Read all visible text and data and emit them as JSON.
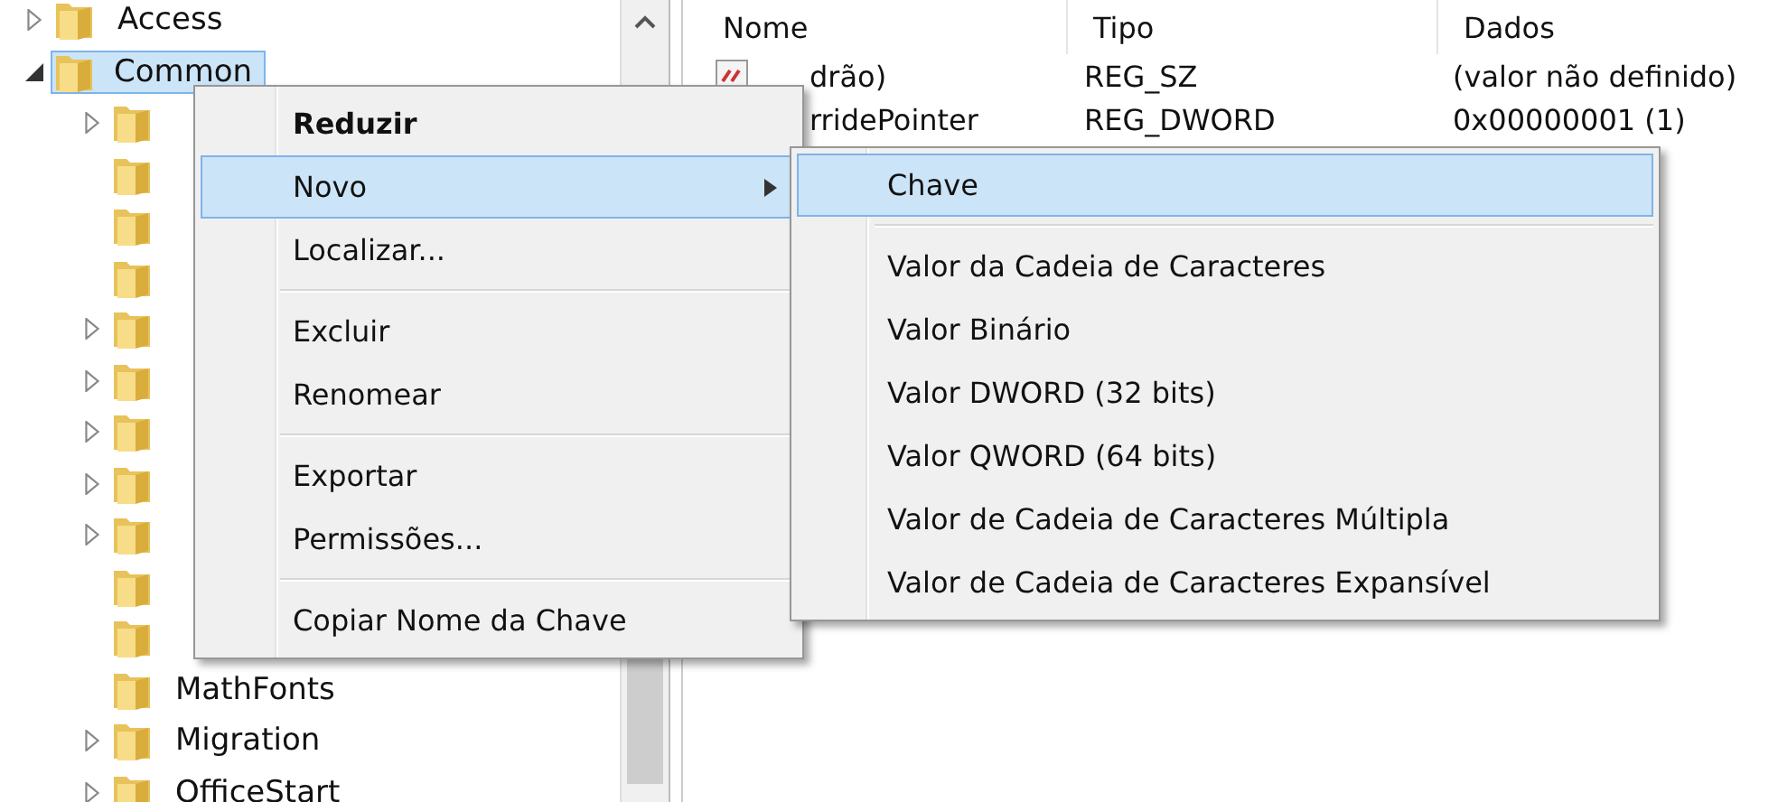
{
  "tree": {
    "items": [
      {
        "label": "Access",
        "expanded": false,
        "selected": false
      },
      {
        "label": "Common",
        "expanded": true,
        "selected": true,
        "children": [
          {
            "expanded": false,
            "selected": false
          },
          {
            "selected": false
          },
          {
            "selected": false
          },
          {
            "selected": false
          },
          {
            "expanded": false,
            "selected": false
          },
          {
            "expanded": false,
            "selected": false
          },
          {
            "expanded": false,
            "selected": false
          },
          {
            "expanded": false,
            "selected": false
          },
          {
            "expanded": false,
            "selected": false
          },
          {
            "selected": false
          },
          {
            "selected": false
          },
          {
            "label": "MathFonts",
            "selected": false
          },
          {
            "label": "Migration",
            "expanded": false,
            "selected": false
          },
          {
            "label": "OfficeStart",
            "expanded": false,
            "selected": false
          }
        ]
      }
    ]
  },
  "values_table": {
    "columns": [
      "Nome",
      "Tipo",
      "Dados"
    ],
    "rows": [
      {
        "name": "drão)",
        "type": "REG_SZ",
        "data": "(valor não definido)"
      },
      {
        "name": "rridePointer",
        "type": "REG_DWORD",
        "data": "0x00000001 (1)"
      }
    ]
  },
  "context_menu": {
    "items": [
      {
        "kind": "item",
        "label": "Reduzir",
        "bold": true,
        "selected": false,
        "submenu": false
      },
      {
        "kind": "item",
        "label": "Novo",
        "bold": false,
        "selected": true,
        "submenu": true
      },
      {
        "kind": "item",
        "label": "Localizar...",
        "bold": false,
        "selected": false,
        "submenu": false
      },
      {
        "kind": "separator"
      },
      {
        "kind": "item",
        "label": "Excluir",
        "bold": false,
        "selected": false,
        "submenu": false
      },
      {
        "kind": "item",
        "label": "Renomear",
        "bold": false,
        "selected": false,
        "submenu": false
      },
      {
        "kind": "separator"
      },
      {
        "kind": "item",
        "label": "Exportar",
        "bold": false,
        "selected": false,
        "submenu": false
      },
      {
        "kind": "item",
        "label": "Permissões...",
        "bold": false,
        "selected": false,
        "submenu": false
      },
      {
        "kind": "separator"
      },
      {
        "kind": "item",
        "label": "Copiar Nome da Chave",
        "bold": false,
        "selected": false,
        "submenu": false
      }
    ]
  },
  "submenu": {
    "items": [
      {
        "kind": "item",
        "label": "Chave",
        "selected": true
      },
      {
        "kind": "separator"
      },
      {
        "kind": "item",
        "label": "Valor da Cadeia de Caracteres",
        "selected": false
      },
      {
        "kind": "item",
        "label": "Valor Binário",
        "selected": false
      },
      {
        "kind": "item",
        "label": "Valor DWORD (32 bits)",
        "selected": false
      },
      {
        "kind": "item",
        "label": "Valor QWORD (64 bits)",
        "selected": false
      },
      {
        "kind": "item",
        "label": "Valor de Cadeia de Caracteres Múltipla",
        "selected": false
      },
      {
        "kind": "item",
        "label": "Valor de Cadeia de Caracteres Expansível",
        "selected": false
      }
    ]
  }
}
